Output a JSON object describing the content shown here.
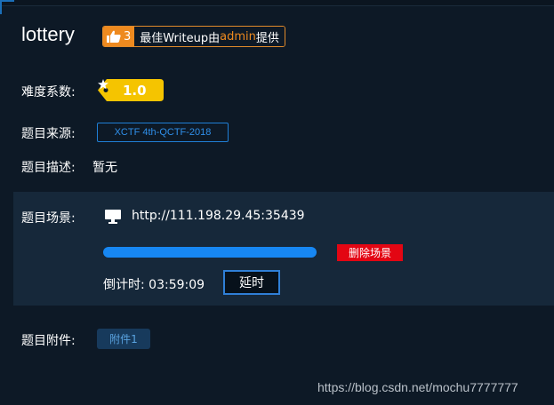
{
  "challenge": {
    "title": "lottery",
    "writeup_badge": {
      "count": "3",
      "text_prefix": "最佳Writeup由",
      "author": "admin",
      "text_suffix": "提供",
      "icon": "thumbs-up-icon"
    }
  },
  "difficulty": {
    "label": "难度系数:",
    "value": "1.0",
    "icon": "star-icon"
  },
  "source": {
    "label": "题目来源:",
    "value": "XCTF 4th-QCTF-2018"
  },
  "description": {
    "label": "题目描述:",
    "value": "暂无"
  },
  "scene": {
    "label": "题目场景:",
    "url": "http://111.198.29.45:35439",
    "monitor_icon": "monitor-icon",
    "progress_fraction": 1.0,
    "delete_label": "删除场景",
    "countdown_label": "倒计时:",
    "countdown_value": "03:59:09",
    "extend_label": "延时"
  },
  "attachment": {
    "label": "题目附件:",
    "button_label": "附件1"
  },
  "watermark": "https://blog.csdn.net/mochu7777777",
  "colors": {
    "background": "#0d1926",
    "panel": "#16283a",
    "accent_blue": "#1787f2",
    "badge_orange": "#ee8a1f",
    "difficulty_yellow": "#f5c400",
    "danger_red": "#e30613"
  }
}
